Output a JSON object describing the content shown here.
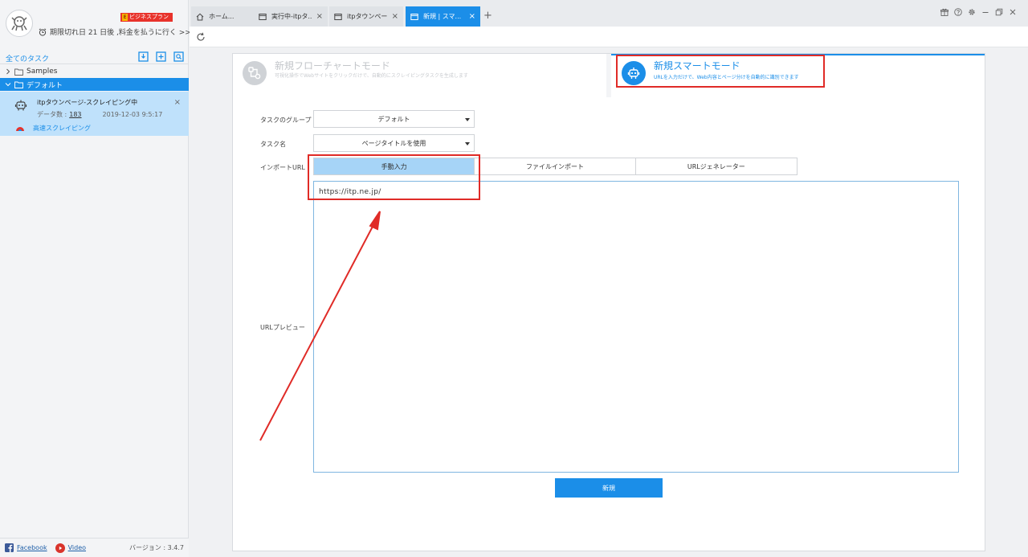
{
  "sidebar": {
    "plan_badge": "ビジネスプラン",
    "plan_mark": "E",
    "expiry_text": "期限切れ日 21 日後 ,料金を払うに行く >>",
    "all_tasks": "全てのタスク",
    "folders": [
      {
        "name": "Samples",
        "expanded": false
      },
      {
        "name": "デフォルト",
        "expanded": true
      }
    ],
    "task": {
      "name": "itpタウンページ-スクレイピング中",
      "count_label": "データ数 :",
      "count": "183",
      "time": "2019-12-03 9:5:17",
      "mode": "高速スクレイピング",
      "close": "×"
    },
    "footer": {
      "facebook": "Facebook",
      "video": "Video",
      "version": "バージョン : 3.4.7"
    }
  },
  "tabs": [
    {
      "label": "ホーム...",
      "close": "",
      "active": false
    },
    {
      "label": "実行中-itpタ...",
      "close": "×",
      "active": false
    },
    {
      "label": "itpタウンペー...",
      "close": "×",
      "active": false
    },
    {
      "label": "新規 | スマ...",
      "close": "×",
      "active": true
    }
  ],
  "tab_add": "+",
  "modes": {
    "flow": {
      "title": "新規フローチャートモード",
      "desc": "可視化操作でWebサイトをクリックだけで、自動的にスクレイピングタスクを生成します"
    },
    "smart": {
      "title": "新規スマートモード",
      "desc": "URLを入力だけで、Web内容とページ分けを自動的に識別できます"
    }
  },
  "form": {
    "group_label": "タスクのグループ",
    "group_value": "デフォルト",
    "name_label": "タスク名",
    "name_value": "ページタイトルを使用",
    "import_label": "インポートURL",
    "import_tabs": [
      "手動入力",
      "ファイルインポート",
      "URLジェネレーター"
    ],
    "url_value": "https://itp.ne.jp/",
    "preview_label": "URLプレビュー",
    "submit": "新規"
  },
  "colors": {
    "accent": "#1b8ee8",
    "annotation": "#e02b27"
  }
}
